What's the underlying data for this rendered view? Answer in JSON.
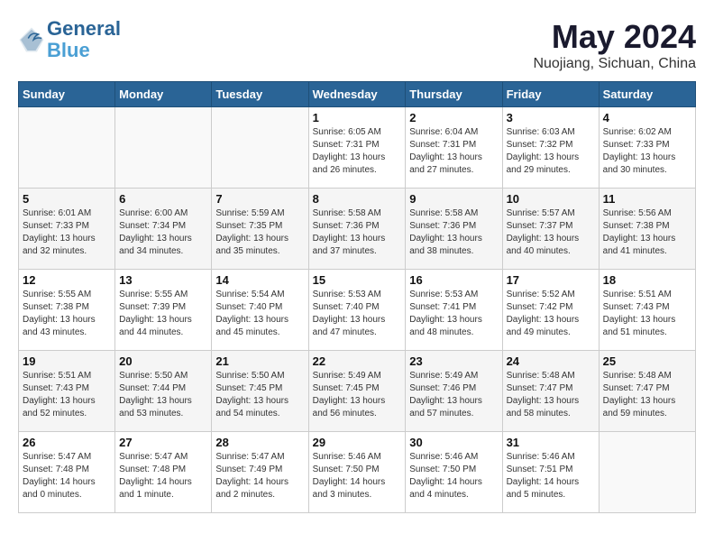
{
  "logo": {
    "line1": "General",
    "line2": "Blue"
  },
  "title": "May 2024",
  "location": "Nuojiang, Sichuan, China",
  "days_header": [
    "Sunday",
    "Monday",
    "Tuesday",
    "Wednesday",
    "Thursday",
    "Friday",
    "Saturday"
  ],
  "weeks": [
    [
      {
        "day": "",
        "sunrise": "",
        "sunset": "",
        "daylight": ""
      },
      {
        "day": "",
        "sunrise": "",
        "sunset": "",
        "daylight": ""
      },
      {
        "day": "",
        "sunrise": "",
        "sunset": "",
        "daylight": ""
      },
      {
        "day": "1",
        "sunrise": "Sunrise: 6:05 AM",
        "sunset": "Sunset: 7:31 PM",
        "daylight": "Daylight: 13 hours and 26 minutes."
      },
      {
        "day": "2",
        "sunrise": "Sunrise: 6:04 AM",
        "sunset": "Sunset: 7:31 PM",
        "daylight": "Daylight: 13 hours and 27 minutes."
      },
      {
        "day": "3",
        "sunrise": "Sunrise: 6:03 AM",
        "sunset": "Sunset: 7:32 PM",
        "daylight": "Daylight: 13 hours and 29 minutes."
      },
      {
        "day": "4",
        "sunrise": "Sunrise: 6:02 AM",
        "sunset": "Sunset: 7:33 PM",
        "daylight": "Daylight: 13 hours and 30 minutes."
      }
    ],
    [
      {
        "day": "5",
        "sunrise": "Sunrise: 6:01 AM",
        "sunset": "Sunset: 7:33 PM",
        "daylight": "Daylight: 13 hours and 32 minutes."
      },
      {
        "day": "6",
        "sunrise": "Sunrise: 6:00 AM",
        "sunset": "Sunset: 7:34 PM",
        "daylight": "Daylight: 13 hours and 34 minutes."
      },
      {
        "day": "7",
        "sunrise": "Sunrise: 5:59 AM",
        "sunset": "Sunset: 7:35 PM",
        "daylight": "Daylight: 13 hours and 35 minutes."
      },
      {
        "day": "8",
        "sunrise": "Sunrise: 5:58 AM",
        "sunset": "Sunset: 7:36 PM",
        "daylight": "Daylight: 13 hours and 37 minutes."
      },
      {
        "day": "9",
        "sunrise": "Sunrise: 5:58 AM",
        "sunset": "Sunset: 7:36 PM",
        "daylight": "Daylight: 13 hours and 38 minutes."
      },
      {
        "day": "10",
        "sunrise": "Sunrise: 5:57 AM",
        "sunset": "Sunset: 7:37 PM",
        "daylight": "Daylight: 13 hours and 40 minutes."
      },
      {
        "day": "11",
        "sunrise": "Sunrise: 5:56 AM",
        "sunset": "Sunset: 7:38 PM",
        "daylight": "Daylight: 13 hours and 41 minutes."
      }
    ],
    [
      {
        "day": "12",
        "sunrise": "Sunrise: 5:55 AM",
        "sunset": "Sunset: 7:38 PM",
        "daylight": "Daylight: 13 hours and 43 minutes."
      },
      {
        "day": "13",
        "sunrise": "Sunrise: 5:55 AM",
        "sunset": "Sunset: 7:39 PM",
        "daylight": "Daylight: 13 hours and 44 minutes."
      },
      {
        "day": "14",
        "sunrise": "Sunrise: 5:54 AM",
        "sunset": "Sunset: 7:40 PM",
        "daylight": "Daylight: 13 hours and 45 minutes."
      },
      {
        "day": "15",
        "sunrise": "Sunrise: 5:53 AM",
        "sunset": "Sunset: 7:40 PM",
        "daylight": "Daylight: 13 hours and 47 minutes."
      },
      {
        "day": "16",
        "sunrise": "Sunrise: 5:53 AM",
        "sunset": "Sunset: 7:41 PM",
        "daylight": "Daylight: 13 hours and 48 minutes."
      },
      {
        "day": "17",
        "sunrise": "Sunrise: 5:52 AM",
        "sunset": "Sunset: 7:42 PM",
        "daylight": "Daylight: 13 hours and 49 minutes."
      },
      {
        "day": "18",
        "sunrise": "Sunrise: 5:51 AM",
        "sunset": "Sunset: 7:43 PM",
        "daylight": "Daylight: 13 hours and 51 minutes."
      }
    ],
    [
      {
        "day": "19",
        "sunrise": "Sunrise: 5:51 AM",
        "sunset": "Sunset: 7:43 PM",
        "daylight": "Daylight: 13 hours and 52 minutes."
      },
      {
        "day": "20",
        "sunrise": "Sunrise: 5:50 AM",
        "sunset": "Sunset: 7:44 PM",
        "daylight": "Daylight: 13 hours and 53 minutes."
      },
      {
        "day": "21",
        "sunrise": "Sunrise: 5:50 AM",
        "sunset": "Sunset: 7:45 PM",
        "daylight": "Daylight: 13 hours and 54 minutes."
      },
      {
        "day": "22",
        "sunrise": "Sunrise: 5:49 AM",
        "sunset": "Sunset: 7:45 PM",
        "daylight": "Daylight: 13 hours and 56 minutes."
      },
      {
        "day": "23",
        "sunrise": "Sunrise: 5:49 AM",
        "sunset": "Sunset: 7:46 PM",
        "daylight": "Daylight: 13 hours and 57 minutes."
      },
      {
        "day": "24",
        "sunrise": "Sunrise: 5:48 AM",
        "sunset": "Sunset: 7:47 PM",
        "daylight": "Daylight: 13 hours and 58 minutes."
      },
      {
        "day": "25",
        "sunrise": "Sunrise: 5:48 AM",
        "sunset": "Sunset: 7:47 PM",
        "daylight": "Daylight: 13 hours and 59 minutes."
      }
    ],
    [
      {
        "day": "26",
        "sunrise": "Sunrise: 5:47 AM",
        "sunset": "Sunset: 7:48 PM",
        "daylight": "Daylight: 14 hours and 0 minutes."
      },
      {
        "day": "27",
        "sunrise": "Sunrise: 5:47 AM",
        "sunset": "Sunset: 7:48 PM",
        "daylight": "Daylight: 14 hours and 1 minute."
      },
      {
        "day": "28",
        "sunrise": "Sunrise: 5:47 AM",
        "sunset": "Sunset: 7:49 PM",
        "daylight": "Daylight: 14 hours and 2 minutes."
      },
      {
        "day": "29",
        "sunrise": "Sunrise: 5:46 AM",
        "sunset": "Sunset: 7:50 PM",
        "daylight": "Daylight: 14 hours and 3 minutes."
      },
      {
        "day": "30",
        "sunrise": "Sunrise: 5:46 AM",
        "sunset": "Sunset: 7:50 PM",
        "daylight": "Daylight: 14 hours and 4 minutes."
      },
      {
        "day": "31",
        "sunrise": "Sunrise: 5:46 AM",
        "sunset": "Sunset: 7:51 PM",
        "daylight": "Daylight: 14 hours and 5 minutes."
      },
      {
        "day": "",
        "sunrise": "",
        "sunset": "",
        "daylight": ""
      }
    ]
  ]
}
